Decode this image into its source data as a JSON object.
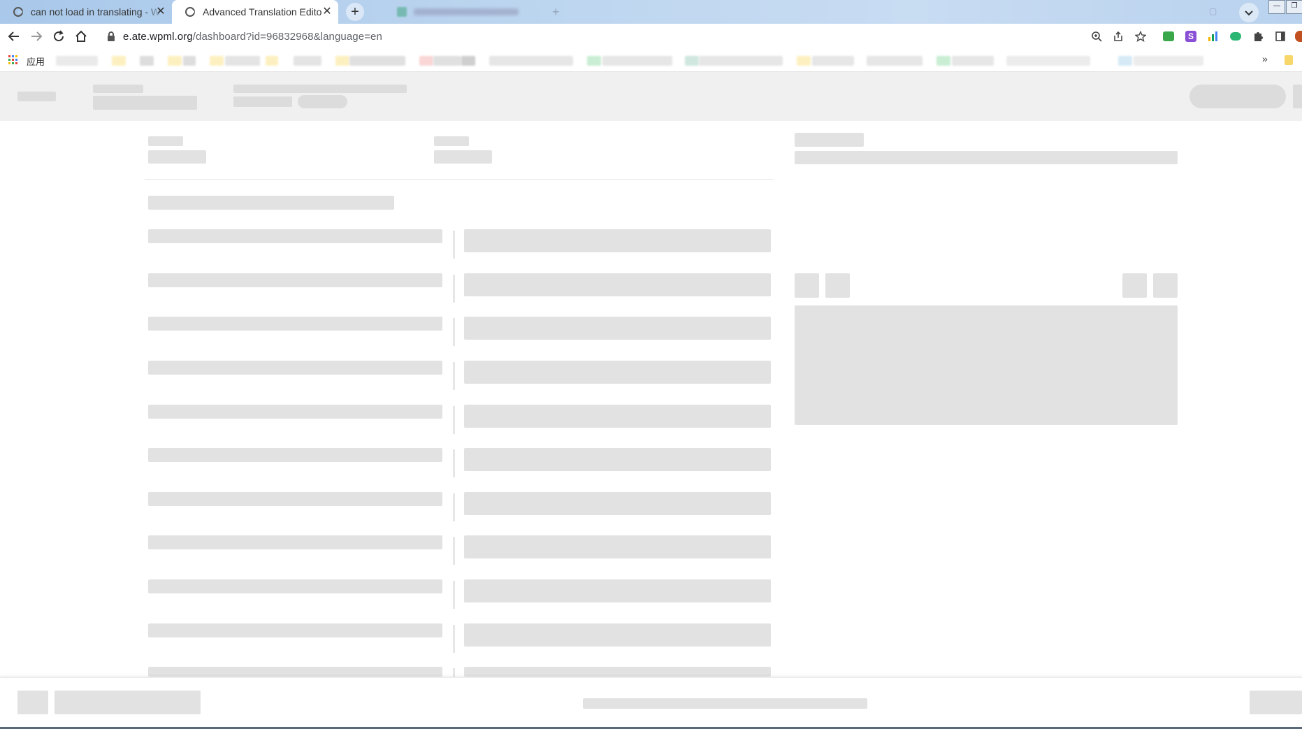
{
  "browser": {
    "tabs": [
      {
        "title": "can not load in translating - W",
        "active": false
      },
      {
        "title": "Advanced Translation Editor - ",
        "active": true
      }
    ],
    "new_tab_label": "+",
    "address": {
      "host": "e.ate.wpml.org",
      "path": "/dashboard?id=96832968&language=en"
    },
    "bookmarks_apps_label": "应用",
    "bookmarks_overflow": "»"
  },
  "colors": {
    "tabstrip": "#b9d2ee",
    "skeleton": "#e2e2e2",
    "header_band": "#f0f0f0"
  }
}
